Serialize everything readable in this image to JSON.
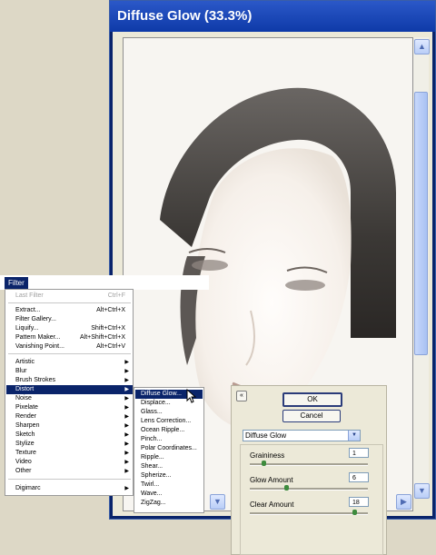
{
  "window": {
    "title": "Diffuse Glow (33.3%)"
  },
  "filter_menu": {
    "title": "Filter",
    "items": [
      {
        "label": "Last Filter",
        "shortcut": "Ctrl+F",
        "disabled": true
      },
      {
        "label": "Extract...",
        "shortcut": "Alt+Ctrl+X"
      },
      {
        "label": "Filter Gallery..."
      },
      {
        "label": "Liquify...",
        "shortcut": "Shift+Ctrl+X"
      },
      {
        "label": "Pattern Maker...",
        "shortcut": "Alt+Shift+Ctrl+X"
      },
      {
        "label": "Vanishing Point...",
        "shortcut": "Alt+Ctrl+V"
      },
      {
        "label": "Artistic",
        "submenu": true
      },
      {
        "label": "Blur",
        "submenu": true
      },
      {
        "label": "Brush Strokes",
        "submenu": true
      },
      {
        "label": "Distort",
        "submenu": true,
        "active": true
      },
      {
        "label": "Noise",
        "submenu": true
      },
      {
        "label": "Pixelate",
        "submenu": true
      },
      {
        "label": "Render",
        "submenu": true
      },
      {
        "label": "Sharpen",
        "submenu": true
      },
      {
        "label": "Sketch",
        "submenu": true
      },
      {
        "label": "Stylize",
        "submenu": true
      },
      {
        "label": "Texture",
        "submenu": true
      },
      {
        "label": "Video",
        "submenu": true
      },
      {
        "label": "Other",
        "submenu": true
      },
      {
        "label": "Digimarc",
        "submenu": true
      }
    ]
  },
  "distort_submenu": {
    "items": [
      "Diffuse Glow...",
      "Displace...",
      "Glass...",
      "Lens Correction...",
      "Ocean Ripple...",
      "Pinch...",
      "Polar Coordinates...",
      "Ripple...",
      "Shear...",
      "Spherize...",
      "Twirl...",
      "Wave...",
      "ZigZag..."
    ],
    "active_index": 0
  },
  "settings_panel": {
    "ok_label": "OK",
    "cancel_label": "Cancel",
    "filter_select": "Diffuse Glow",
    "params": [
      {
        "label": "Graininess",
        "value": "1",
        "fraction": 0.1
      },
      {
        "label": "Glow Amount",
        "value": "6",
        "fraction": 0.3
      },
      {
        "label": "Clear Amount",
        "value": "18",
        "fraction": 0.9
      }
    ]
  },
  "icons": {
    "collapse": "chevron-double-up-icon",
    "scroll_up": "chevron-up-icon",
    "scroll_down": "chevron-down-icon",
    "scroll_right": "chevron-right-icon",
    "submenu": "triangle-right-icon",
    "cursor": "mouse-pointer-icon"
  },
  "colors": {
    "titlebar": "#0e3aa8",
    "menu_highlight": "#0a246a",
    "slider_knob": "#3d8b3d"
  }
}
